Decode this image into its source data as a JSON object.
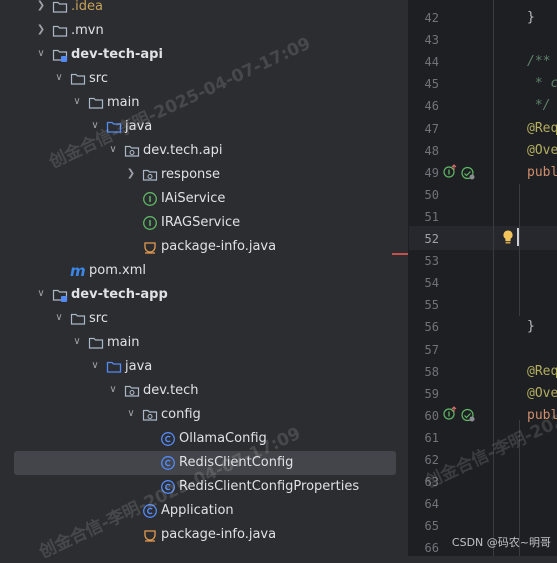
{
  "project_tree": {
    "items": [
      {
        "label": ".idea",
        "icon": "folder-icon",
        "expand": "collapsed",
        "style": "idea"
      },
      {
        "label": ".mvn",
        "icon": "folder-icon",
        "expand": "collapsed",
        "style": "normal"
      },
      {
        "label": "dev-tech-api",
        "icon": "module-folder-icon",
        "expand": "expanded",
        "style": "bold"
      },
      {
        "label": "src",
        "icon": "folder-icon",
        "expand": "expanded",
        "style": "normal"
      },
      {
        "label": "main",
        "icon": "folder-icon",
        "expand": "expanded",
        "style": "normal"
      },
      {
        "label": "java",
        "icon": "source-root-folder-icon",
        "expand": "expanded",
        "style": "normal"
      },
      {
        "label": "dev.tech.api",
        "icon": "package-icon",
        "expand": "expanded",
        "style": "normal"
      },
      {
        "label": "response",
        "icon": "package-icon",
        "expand": "collapsed",
        "style": "normal"
      },
      {
        "label": "IAiService",
        "icon": "interface-icon",
        "expand": "none",
        "style": "normal"
      },
      {
        "label": "IRAGService",
        "icon": "interface-icon",
        "expand": "none",
        "style": "normal"
      },
      {
        "label": "package-info.java",
        "icon": "java-file-icon",
        "expand": "none",
        "style": "normal"
      },
      {
        "label": "pom.xml",
        "icon": "maven-icon",
        "expand": "none",
        "style": "normal"
      },
      {
        "label": "dev-tech-app",
        "icon": "module-folder-icon",
        "expand": "expanded",
        "style": "bold"
      },
      {
        "label": "src",
        "icon": "folder-icon",
        "expand": "expanded",
        "style": "normal"
      },
      {
        "label": "main",
        "icon": "folder-icon",
        "expand": "expanded",
        "style": "normal"
      },
      {
        "label": "java",
        "icon": "source-root-folder-icon",
        "expand": "expanded",
        "style": "normal"
      },
      {
        "label": "dev.tech",
        "icon": "package-icon",
        "expand": "expanded",
        "style": "normal"
      },
      {
        "label": "config",
        "icon": "package-icon",
        "expand": "expanded",
        "style": "normal"
      },
      {
        "label": "OllamaConfig",
        "icon": "class-icon",
        "expand": "none",
        "style": "normal"
      },
      {
        "label": "RedisClientConfig",
        "icon": "class-icon",
        "expand": "none",
        "style": "normal",
        "selected": true
      },
      {
        "label": "RedisClientConfigProperties",
        "icon": "class-icon",
        "expand": "none",
        "style": "normal"
      },
      {
        "label": "Application",
        "icon": "class-icon",
        "expand": "none",
        "style": "normal"
      },
      {
        "label": "package-info.java",
        "icon": "java-file-icon",
        "expand": "none",
        "style": "normal"
      }
    ]
  },
  "editor": {
    "current_line": "52",
    "lines": [
      {
        "num": "42",
        "code": "}",
        "cls": "c-brace"
      },
      {
        "num": "43",
        "code": "",
        "cls": ""
      },
      {
        "num": "44",
        "code": "/**",
        "cls": "c-comment"
      },
      {
        "num": "45",
        "code": " * c",
        "cls": "c-comment"
      },
      {
        "num": "46",
        "code": " */",
        "cls": "c-comment"
      },
      {
        "num": "47",
        "code": "@Req",
        "cls": "c-anno"
      },
      {
        "num": "48",
        "code": "@Ove",
        "cls": "c-anno"
      },
      {
        "num": "49",
        "code": "publ",
        "cls": "c-kw"
      },
      {
        "num": "50",
        "code": "",
        "cls": ""
      },
      {
        "num": "51",
        "code": "",
        "cls": ""
      },
      {
        "num": "52",
        "code": "",
        "cls": ""
      },
      {
        "num": "53",
        "code": "",
        "cls": ""
      },
      {
        "num": "54",
        "code": "",
        "cls": ""
      },
      {
        "num": "55",
        "code": "",
        "cls": ""
      },
      {
        "num": "56",
        "code": "}",
        "cls": "c-brace"
      },
      {
        "num": "57",
        "code": "",
        "cls": ""
      },
      {
        "num": "58",
        "code": "@Req",
        "cls": "c-anno"
      },
      {
        "num": "59",
        "code": "@Ove",
        "cls": "c-anno"
      },
      {
        "num": "60",
        "code": "publ",
        "cls": "c-kw"
      },
      {
        "num": "61",
        "code": "",
        "cls": ""
      },
      {
        "num": "62",
        "code": "",
        "cls": ""
      },
      {
        "num": "63",
        "code": "",
        "cls": ""
      },
      {
        "num": "64",
        "code": "",
        "cls": ""
      },
      {
        "num": "65",
        "code": "",
        "cls": ""
      },
      {
        "num": "66",
        "code": "",
        "cls": ""
      }
    ],
    "gutter_icons": [
      "implement-override-icon",
      "spring-web-icon",
      "lightbulb-icon"
    ]
  },
  "watermark": {
    "text1": "创金合信-李明-2025-04-07-17:09",
    "text2": "创金合信-李明-2025-04-07-17:09",
    "text3": "创金合信-李明-2025"
  },
  "credit": "CSDN @码农~明哥",
  "colors": {
    "tree_bg": "#2b2d30",
    "editor_bg": "#1e1f22",
    "selection": "#43454a",
    "folder": "#a9b7c6",
    "source_root": "#548af7",
    "interface_green": "#5fb865",
    "class_blue": "#548af7",
    "java_file_orange": "#e49b4f",
    "maven_blue": "#3a87e8"
  }
}
